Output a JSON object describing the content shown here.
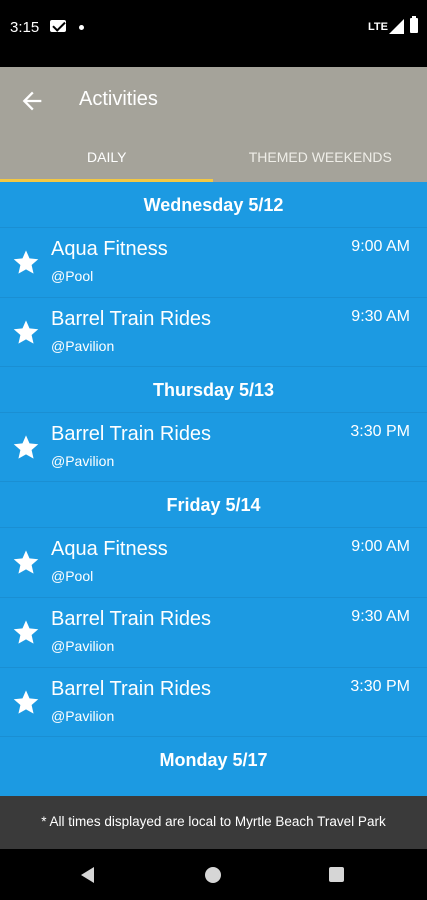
{
  "status": {
    "time": "3:15",
    "network": "LTE"
  },
  "app_bar": {
    "title": "Activities"
  },
  "tabs": [
    {
      "label": "DAILY",
      "selected": true
    },
    {
      "label": "THEMED WEEKENDS",
      "selected": false
    }
  ],
  "days": [
    {
      "header": "Wednesday 5/12",
      "activities": [
        {
          "name": "Aqua Fitness",
          "location": "@Pool",
          "time": "9:00 AM"
        },
        {
          "name": "Barrel Train Rides",
          "location": "@Pavilion",
          "time": "9:30 AM"
        }
      ]
    },
    {
      "header": "Thursday 5/13",
      "activities": [
        {
          "name": "Barrel Train Rides",
          "location": "@Pavilion",
          "time": "3:30 PM"
        }
      ]
    },
    {
      "header": "Friday 5/14",
      "activities": [
        {
          "name": "Aqua Fitness",
          "location": "@Pool",
          "time": "9:00 AM"
        },
        {
          "name": "Barrel Train Rides",
          "location": "@Pavilion",
          "time": "9:30 AM"
        },
        {
          "name": "Barrel Train Rides",
          "location": "@Pavilion",
          "time": "3:30 PM"
        }
      ]
    },
    {
      "header": "Monday 5/17",
      "activities": []
    }
  ],
  "footer": {
    "note": "* All times displayed are local to Myrtle Beach Travel Park"
  },
  "colors": {
    "app_bar": "#a5a39a",
    "content": "#1c9ae2",
    "tab_indicator": "#f4c842",
    "footer": "#3a3a3a"
  },
  "icons": {
    "back": "arrow-left-icon",
    "favorite": "star-icon"
  }
}
